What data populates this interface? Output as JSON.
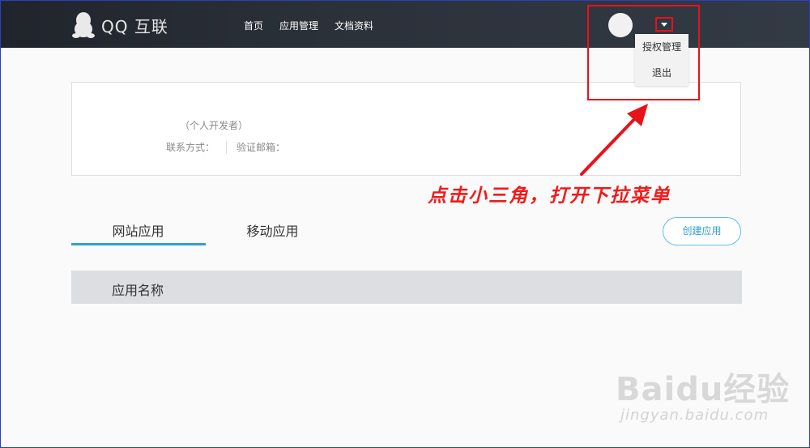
{
  "header": {
    "brand": "QQ 互联",
    "nav": [
      "首页",
      "应用管理",
      "文档资料"
    ]
  },
  "dropdown": {
    "items": [
      "授权管理",
      "退出"
    ]
  },
  "profile": {
    "developer_type": "（个人开发者）",
    "contact_label": "联系方式：",
    "email_label": "验证邮箱："
  },
  "tabs": {
    "website": "网站应用",
    "mobile": "移动应用"
  },
  "actions": {
    "create": "创建应用"
  },
  "table": {
    "header": "应用名称"
  },
  "annotation": {
    "text": "点击小三角，打开下拉菜单"
  },
  "watermark": {
    "brand": "Baidu经验",
    "url": "jingyan.baidu.com"
  },
  "colors": {
    "accent": "#2e9fd7",
    "annotation": "#e8121a",
    "header_bg": "#2b3139"
  }
}
